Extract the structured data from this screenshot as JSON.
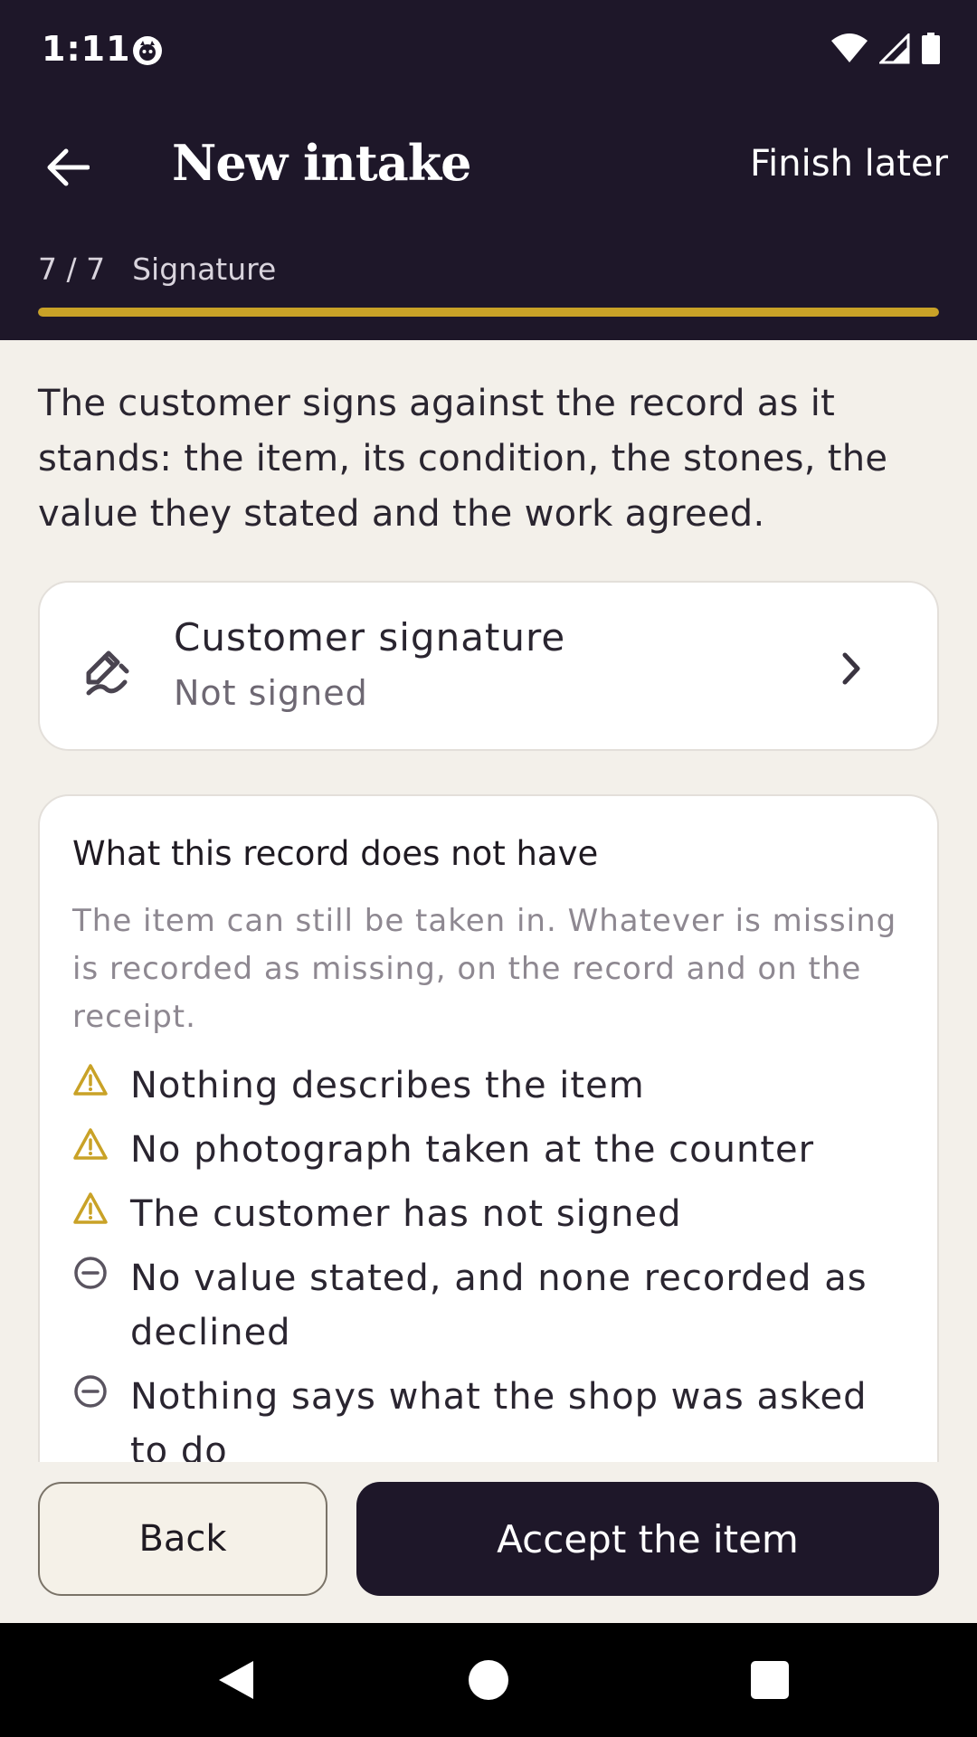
{
  "status_bar": {
    "time": "1:11",
    "icons": [
      "app-notification-icon",
      "wifi-icon",
      "signal-icon",
      "battery-icon"
    ]
  },
  "app_bar": {
    "title": "New intake",
    "finish_later_label": "Finish later",
    "back_icon": "arrow-left-icon"
  },
  "progress": {
    "step_counter": "7 / 7",
    "step_name": "Signature",
    "fraction": 1.0,
    "color": "#C9A227"
  },
  "intro_text": "The customer signs against the record as it stands: the item, its condition, the stones, the value they stated and the work agreed.",
  "signature_card": {
    "title": "Customer signature",
    "status": "Not signed",
    "icon": "signature-pen-icon"
  },
  "missing_card": {
    "title": "What this record does not have",
    "description": "The item can still be taken in. Whatever is missing is recorded as missing, on the record and on the receipt.",
    "items": [
      {
        "icon": "warning-icon",
        "text": "Nothing describes the item"
      },
      {
        "icon": "warning-icon",
        "text": "No photograph taken at the counter"
      },
      {
        "icon": "warning-icon",
        "text": "The customer has not signed"
      },
      {
        "icon": "minus-circle-icon",
        "text": "No value stated, and none recorded as declined"
      },
      {
        "icon": "minus-circle-icon",
        "text": "Nothing says what the shop was asked to do"
      }
    ]
  },
  "actions": {
    "back_label": "Back",
    "accept_label": "Accept the item"
  },
  "colors": {
    "header_bg": "#1E1729",
    "accent": "#C9A227",
    "page_bg": "#F3F0EA"
  }
}
